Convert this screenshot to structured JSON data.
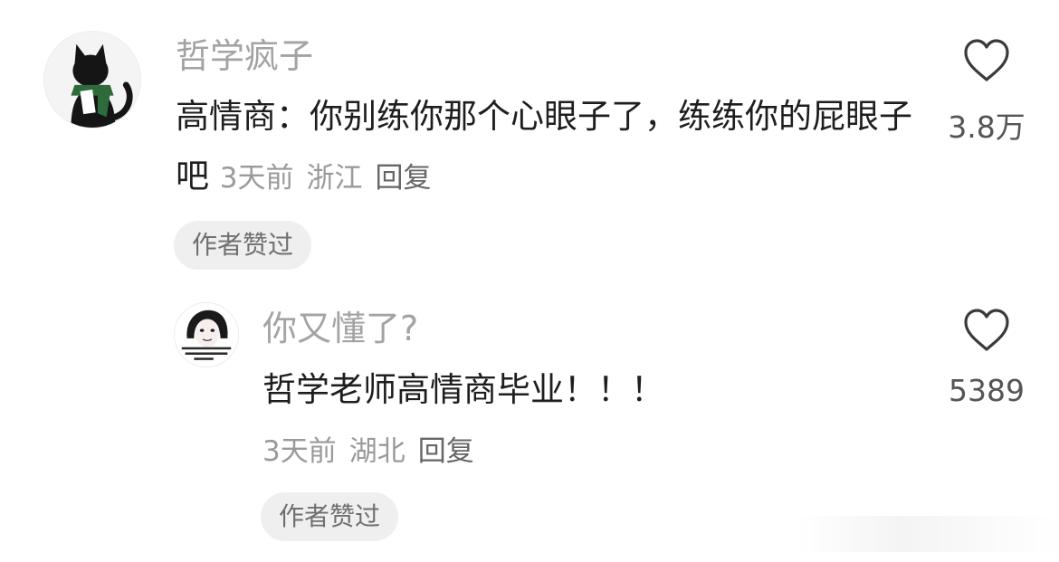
{
  "comments": [
    {
      "username": "哲学疯子",
      "text": "高情商：你别练你那个心眼子了，练练你的屁眼子吧",
      "time": "3天前",
      "location": "浙江",
      "reply": "回复",
      "badge": "作者赞过",
      "likes": "3.8万",
      "avatar_icon": "black-cat-avatar"
    },
    {
      "username": "你又懂了?",
      "text": "哲学老师高情商毕业！！！",
      "time": "3天前",
      "location": "湖北",
      "reply": "回复",
      "badge": "作者赞过",
      "likes": "5389",
      "avatar_icon": "meme-face-avatar"
    }
  ],
  "colors": {
    "username": "#a3a3a3",
    "text": "#1e1e1e",
    "meta": "#9a9a9a",
    "badge_bg": "#efefef"
  }
}
